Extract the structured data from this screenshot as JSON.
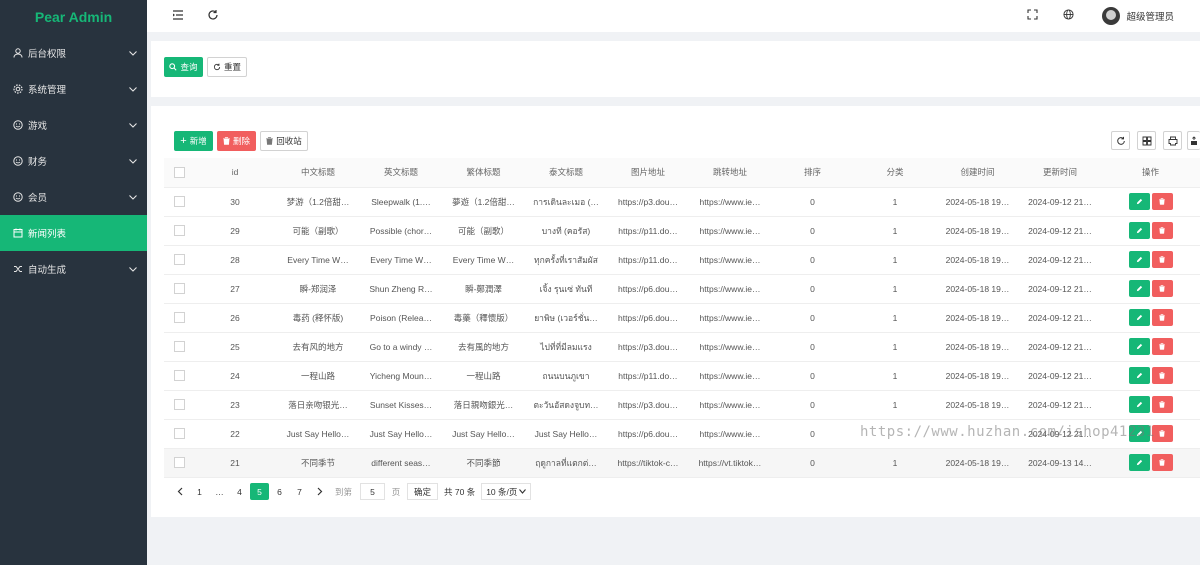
{
  "app": {
    "logo": "Pear Admin"
  },
  "sidebar": {
    "items": [
      {
        "label": "后台权限",
        "icon": "user-icon"
      },
      {
        "label": "系统管理",
        "icon": "gear-icon"
      },
      {
        "label": "游戏",
        "icon": "smile-icon"
      },
      {
        "label": "财务",
        "icon": "smile-icon"
      },
      {
        "label": "会员",
        "icon": "smile-icon"
      },
      {
        "label": "新闻列表",
        "icon": "calendar-icon"
      },
      {
        "label": "自动生成",
        "icon": "shuffle-icon"
      }
    ],
    "active_index": 5
  },
  "header": {
    "user_name": "超级管理员"
  },
  "search": {
    "query_label": "查询",
    "reset_label": "重置"
  },
  "toolbar": {
    "add_label": "新增",
    "delete_label": "删除",
    "recycle_label": "回收站"
  },
  "table": {
    "headers": [
      "id",
      "中文标题",
      "英文标题",
      "繁体标题",
      "泰文标题",
      "图片地址",
      "跳转地址",
      "排序",
      "分类",
      "创建时间",
      "更新时间",
      "操作"
    ],
    "rows": [
      [
        "30",
        "梦游（1.2倍甜…",
        "Sleepwalk (1.…",
        "夢遊（1.2倍甜…",
        "การเดินละเมอ (…",
        "https://p3.dou…",
        "https://www.ie…",
        "0",
        "1",
        "2024-05-18 19…",
        "2024-09-12 21…"
      ],
      [
        "29",
        "可能（副歌）",
        "Possible (chor…",
        "可能（副歌）",
        "บางที (คอรัส)",
        "https://p11.do…",
        "https://www.ie…",
        "0",
        "1",
        "2024-05-18 19…",
        "2024-09-12 21…"
      ],
      [
        "28",
        "Every Time W…",
        "Every Time W…",
        "Every Time W…",
        "ทุกครั้งที่เราสัมผัส",
        "https://p11.do…",
        "https://www.ie…",
        "0",
        "1",
        "2024-05-18 19…",
        "2024-09-12 21…"
      ],
      [
        "27",
        "瞬-郑润泽",
        "Shun Zheng R…",
        "瞬-鄭潤澤",
        "เจิ้ง รุนเซ่ ทันที",
        "https://p6.dou…",
        "https://www.ie…",
        "0",
        "1",
        "2024-05-18 19…",
        "2024-09-12 21…"
      ],
      [
        "26",
        "毒药 (释怀版)",
        "Poison (Relea…",
        "毒藥（釋懷版）",
        "ยาพิษ (เวอร์ชั่น…",
        "https://p6.dou…",
        "https://www.ie…",
        "0",
        "1",
        "2024-05-18 19…",
        "2024-09-12 21…"
      ],
      [
        "25",
        "去有风的地方",
        "Go to a windy …",
        "去有風的地方",
        "ไปที่ที่มีลมแรง",
        "https://p3.dou…",
        "https://www.ie…",
        "0",
        "1",
        "2024-05-18 19…",
        "2024-09-12 21…"
      ],
      [
        "24",
        "一程山路",
        "Yicheng Moun…",
        "一程山路",
        "ถนนบนภูเขา",
        "https://p11.do…",
        "https://www.ie…",
        "0",
        "1",
        "2024-05-18 19…",
        "2024-09-12 21…"
      ],
      [
        "23",
        "落日亲吻银光…",
        "Sunset Kisses…",
        "落日親吻銀光…",
        "ตะวันอัสดงจูบท…",
        "https://p3.dou…",
        "https://www.ie…",
        "0",
        "1",
        "2024-05-18 19…",
        "2024-09-12 21…"
      ],
      [
        "22",
        "Just Say Hello…",
        "Just Say Hello…",
        "Just Say Hello…",
        "Just Say Hello…",
        "https://p6.dou…",
        "https://www.ie…",
        "0",
        "",
        "",
        "2024-09-12 21…"
      ],
      [
        "21",
        "不同季节",
        "different seas…",
        "不同季節",
        "ฤดูกาลที่แตกต่…",
        "https://tiktok-c…",
        "https://vt.tiktok…",
        "0",
        "1",
        "2024-05-18 19…",
        "2024-09-13 14…"
      ]
    ]
  },
  "pagination": {
    "pages": [
      "1",
      "…",
      "4",
      "5",
      "6",
      "7"
    ],
    "current": "5",
    "goto_prefix": "到第",
    "goto_value": "5",
    "goto_suffix": "页",
    "confirm_label": "确定",
    "total_text": "共 70 条",
    "page_size": "10 条/页"
  },
  "watermark": "https://www.huzhan.com/ishop41231"
}
